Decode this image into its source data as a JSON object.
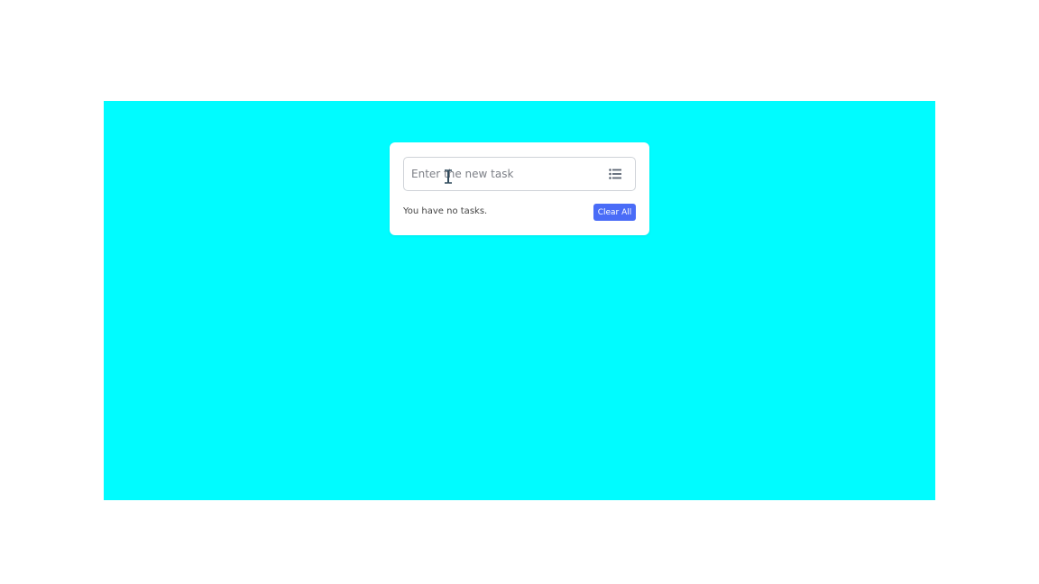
{
  "task_input": {
    "placeholder": "Enter the new task",
    "value": ""
  },
  "icons": {
    "list": "list-icon",
    "cursor": "text-cursor-icon"
  },
  "status": {
    "text": "You have no tasks."
  },
  "clear_button": {
    "label": "Clear All"
  },
  "colors": {
    "stage_background": "#00fcff",
    "card_background": "#ffffff",
    "accent": "#4a6cf7"
  }
}
